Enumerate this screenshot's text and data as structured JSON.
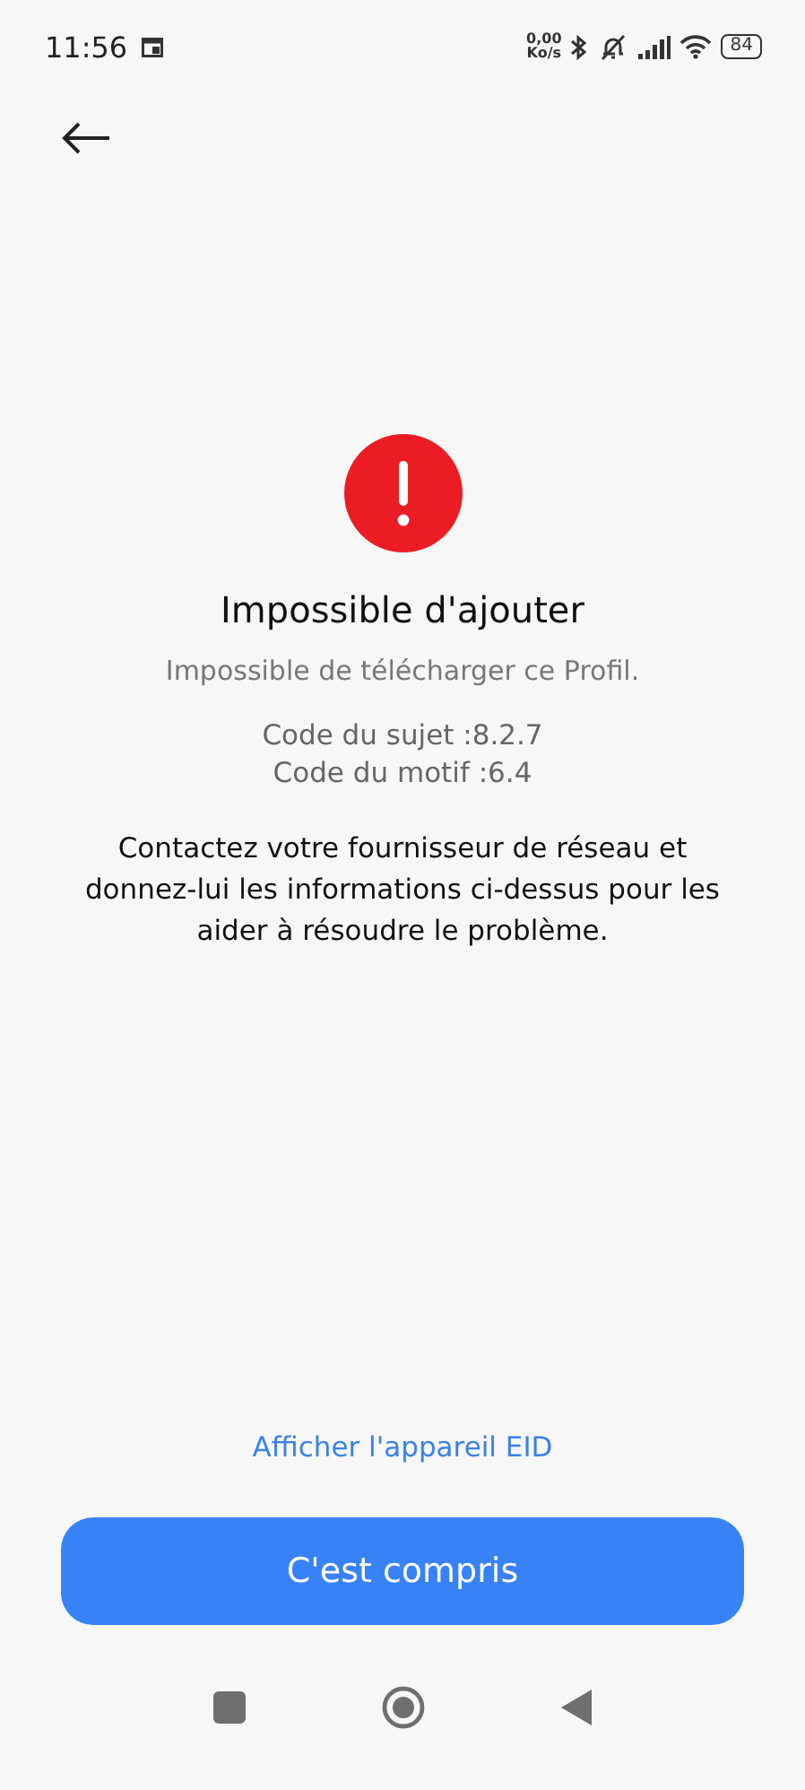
{
  "status_bar": {
    "time": "11:56",
    "net_speed": "0,00",
    "net_unit": "Ko/s",
    "battery": "84"
  },
  "error": {
    "title": "Impossible d'ajouter",
    "subtitle": "Impossible de télécharger ce Profil.",
    "codes": [
      "Code du sujet :8.2.7",
      "Code du motif :6.4"
    ],
    "message": "Contactez votre fournisseur de réseau et donnez-lui les informations ci-dessus pour les aider à résoudre le problème."
  },
  "link": "Afficher l'appareil EID",
  "button": "C'est compris"
}
